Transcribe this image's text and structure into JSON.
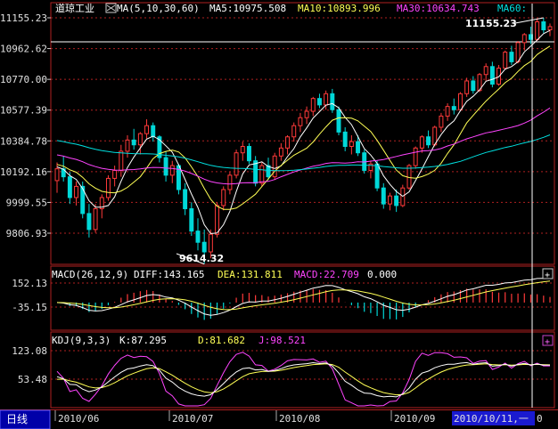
{
  "period_label": "日线",
  "colors": {
    "frame": "#b02020",
    "up": "#ff3a3a",
    "down": "#00d8d8",
    "ma5": "#ffffff",
    "ma10": "#ffff55",
    "ma30": "#ff44ff",
    "ma60": "#00e0e0",
    "dea": "#ffff55",
    "diff": "#ffffff",
    "kdj_j": "#ff44ff",
    "selected_bg": "#1a1ad0",
    "period_bg": "#0000a8"
  },
  "main_header": {
    "name": "道琼工业",
    "ma_param": "MA(5,10,30,60)",
    "ma5": "MA5:10975.508",
    "ma10": "MA10:10893.996",
    "ma30": "MA30:10634.743",
    "ma60": "MA60:"
  },
  "macd_header": {
    "param": "MACD(26,12,9)",
    "diff": "DIFF:143.165",
    "dea": "DEA:131.811",
    "macd": "MACD:22.709",
    "zero": "0.000"
  },
  "kdj_header": {
    "param": "KDJ(9,3,3)",
    "k": "K:87.295",
    "d": "D:81.682",
    "j": "J:98.521"
  },
  "plus_icon_label": "+",
  "selected_date": "2010/10/11,一",
  "cursor_label": "0",
  "chart_data": [
    {
      "type": "candlestick",
      "y_ticks": [
        "11155.23",
        "10962.62",
        "10770.00",
        "10577.39",
        "10384.78",
        "10192.16",
        "9999.55",
        "9806.93"
      ],
      "ylim": [
        9806.93,
        11155.23
      ],
      "x_ticks": [
        "2010/06",
        "2010/07",
        "2010/08",
        "2010/09"
      ],
      "annotations": [
        "11155.23",
        "9614.32"
      ],
      "candles": [
        [
          10136,
          10250,
          10060,
          10210
        ],
        [
          10210,
          10290,
          10130,
          10160
        ],
        [
          10160,
          10190,
          9990,
          10030
        ],
        [
          10030,
          10130,
          9980,
          10100
        ],
        [
          10100,
          10130,
          9900,
          9930
        ],
        [
          9930,
          9990,
          9780,
          9830
        ],
        [
          9830,
          9990,
          9810,
          9960
        ],
        [
          9960,
          10050,
          9900,
          10030
        ],
        [
          10030,
          10170,
          10010,
          10150
        ],
        [
          10150,
          10230,
          10100,
          10200
        ],
        [
          10200,
          10360,
          10160,
          10320
        ],
        [
          10320,
          10420,
          10280,
          10390
        ],
        [
          10390,
          10460,
          10330,
          10360
        ],
        [
          10360,
          10440,
          10300,
          10430
        ],
        [
          10430,
          10520,
          10400,
          10480
        ],
        [
          10480,
          10500,
          10380,
          10410
        ],
        [
          10410,
          10420,
          10250,
          10280
        ],
        [
          10280,
          10320,
          10130,
          10170
        ],
        [
          10170,
          10260,
          10120,
          10230
        ],
        [
          10230,
          10240,
          10050,
          10080
        ],
        [
          10080,
          10120,
          9920,
          9960
        ],
        [
          9960,
          10000,
          9790,
          9820
        ],
        [
          9820,
          9900,
          9700,
          9750
        ],
        [
          9750,
          9830,
          9614,
          9690
        ],
        [
          9690,
          9830,
          9650,
          9800
        ],
        [
          9800,
          10000,
          9780,
          9980
        ],
        [
          9980,
          10100,
          9950,
          10080
        ],
        [
          10080,
          10190,
          10050,
          10170
        ],
        [
          10170,
          10330,
          10150,
          10310
        ],
        [
          10310,
          10380,
          10260,
          10350
        ],
        [
          10350,
          10370,
          10240,
          10260
        ],
        [
          10260,
          10290,
          10100,
          10120
        ],
        [
          10120,
          10250,
          10100,
          10230
        ],
        [
          10230,
          10280,
          10140,
          10160
        ],
        [
          10160,
          10310,
          10140,
          10290
        ],
        [
          10290,
          10370,
          10260,
          10340
        ],
        [
          10340,
          10420,
          10300,
          10410
        ],
        [
          10410,
          10500,
          10380,
          10480
        ],
        [
          10480,
          10560,
          10440,
          10530
        ],
        [
          10530,
          10600,
          10490,
          10570
        ],
        [
          10570,
          10660,
          10540,
          10650
        ],
        [
          10650,
          10680,
          10590,
          10610
        ],
        [
          10610,
          10700,
          10580,
          10680
        ],
        [
          10680,
          10710,
          10560,
          10580
        ],
        [
          10580,
          10600,
          10420,
          10440
        ],
        [
          10440,
          10470,
          10320,
          10350
        ],
        [
          10350,
          10420,
          10300,
          10380
        ],
        [
          10380,
          10420,
          10290,
          10310
        ],
        [
          10310,
          10330,
          10180,
          10200
        ],
        [
          10200,
          10260,
          10150,
          10240
        ],
        [
          10240,
          10260,
          10070,
          10090
        ],
        [
          10090,
          10120,
          9960,
          9990
        ],
        [
          9990,
          10060,
          9950,
          10040
        ],
        [
          10040,
          10080,
          9940,
          9980
        ],
        [
          9980,
          10110,
          9970,
          10090
        ],
        [
          10090,
          10240,
          10080,
          10230
        ],
        [
          10230,
          10350,
          10210,
          10340
        ],
        [
          10340,
          10420,
          10310,
          10410
        ],
        [
          10410,
          10450,
          10340,
          10360
        ],
        [
          10360,
          10480,
          10350,
          10470
        ],
        [
          10470,
          10560,
          10440,
          10540
        ],
        [
          10540,
          10620,
          10510,
          10600
        ],
        [
          10600,
          10650,
          10550,
          10580
        ],
        [
          10580,
          10690,
          10570,
          10680
        ],
        [
          10680,
          10780,
          10660,
          10760
        ],
        [
          10760,
          10790,
          10680,
          10700
        ],
        [
          10700,
          10810,
          10690,
          10800
        ],
        [
          10800,
          10870,
          10760,
          10850
        ],
        [
          10850,
          10880,
          10720,
          10740
        ],
        [
          10740,
          10860,
          10730,
          10840
        ],
        [
          10840,
          10950,
          10830,
          10940
        ],
        [
          10940,
          10980,
          10860,
          10880
        ],
        [
          10880,
          11010,
          10870,
          11000
        ],
        [
          11000,
          11060,
          10950,
          11050
        ],
        [
          11050,
          11100,
          10990,
          11020
        ],
        [
          11020,
          11150,
          11010,
          11130
        ],
        [
          11130,
          11155.23,
          11060,
          11080
        ],
        [
          11080,
          11120,
          11040,
          11100
        ]
      ]
    },
    {
      "type": "bar",
      "title": "MACD(26,12,9)",
      "y_ticks": [
        "152.13",
        "-35.15"
      ],
      "ylim": [
        -90,
        190
      ],
      "x_ticks": [
        "2010/06",
        "2010/07",
        "2010/08",
        "2010/09"
      ]
    },
    {
      "type": "line",
      "title": "KDJ(9,3,3)",
      "y_ticks": [
        "123.08",
        "53.48"
      ],
      "ylim": [
        -20,
        140
      ],
      "x_ticks": [
        "2010/06",
        "2010/07",
        "2010/08",
        "2010/09"
      ]
    }
  ]
}
